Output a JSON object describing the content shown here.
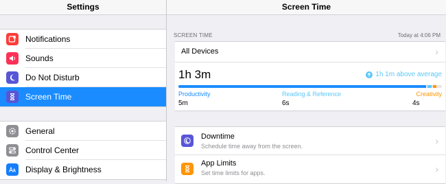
{
  "sidebar": {
    "title": "Settings",
    "group1": [
      {
        "label": "Notifications",
        "icon": "notifications-icon",
        "color": "#fc3d39"
      },
      {
        "label": "Sounds",
        "icon": "speaker-icon",
        "color": "#fc3158"
      },
      {
        "label": "Do Not Disturb",
        "icon": "moon-icon",
        "color": "#5856d6"
      },
      {
        "label": "Screen Time",
        "icon": "hourglass-icon",
        "color": "#5856d6",
        "selected": true
      }
    ],
    "group2": [
      {
        "label": "General",
        "icon": "gear-icon",
        "color": "#8e8e93"
      },
      {
        "label": "Control Center",
        "icon": "toggles-icon",
        "color": "#8e8e93"
      },
      {
        "label": "Display & Brightness",
        "icon": "display-brightness-icon",
        "color": "#147efb"
      }
    ]
  },
  "detail": {
    "title": "Screen Time",
    "section_label": "SCREEN TIME",
    "today_label": "Today at 4:06 PM",
    "devices_label": "All Devices",
    "total_time": "1h 3m",
    "delta": "1h 1m above average",
    "accent": "#1a8cff",
    "usage_shares": [
      {
        "name": "Productivity",
        "share": 0.94,
        "color": "#1a8cff"
      },
      {
        "name": "Reading & Reference",
        "share": 0.015,
        "color": "#5ac8fa"
      },
      {
        "name": "Creativity",
        "share": 0.015,
        "color": "#ff9500"
      }
    ],
    "categories": [
      {
        "name": "Productivity",
        "value": "5m",
        "color": "#1a8cff"
      },
      {
        "name": "Reading & Reference",
        "value": "6s",
        "color": "#5ac8fa"
      },
      {
        "name": "Creativity",
        "value": "4s",
        "color": "#ff9500"
      }
    ],
    "rows": [
      {
        "title": "Downtime",
        "subtitle": "Schedule time away from the screen.",
        "icon": "downtime-icon",
        "color": "#5856d6"
      },
      {
        "title": "App Limits",
        "subtitle": "Set time limits for apps.",
        "icon": "hourglass-icon",
        "color": "#ff9500"
      }
    ]
  }
}
